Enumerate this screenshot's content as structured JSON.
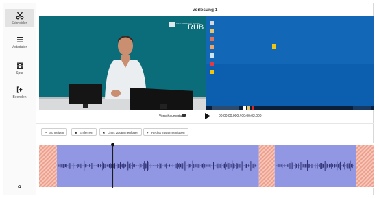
{
  "sidebar": {
    "items": [
      {
        "label": "Schneiden",
        "icon": "scissors-icon"
      },
      {
        "label": "Metadaten",
        "icon": "list-icon"
      },
      {
        "label": "Spur",
        "icon": "film-icon"
      },
      {
        "label": "Beenden",
        "icon": "exit-icon"
      }
    ],
    "settings_icon": "gear-icon"
  },
  "header": {
    "title": "Vorlesung 1"
  },
  "video": {
    "logo_text": "RUB",
    "logo_small": "RUHR UNIVERSITÄT BOCHUM"
  },
  "controls": {
    "previewmode_label": "Vorschaumodus",
    "time_display": "00:00:00.000 / 00:00:02.000"
  },
  "toolbar": {
    "cut_label": "Schneiden",
    "delete_label": "Entfernen",
    "merge_left_label": "Links zusammenfügen",
    "merge_right_label": "Rechts zusammenfügen"
  },
  "timeline": {
    "playhead_position_fraction": 0.22,
    "segments": [
      {
        "state": "deleted",
        "start": 0.0,
        "end": 0.053
      },
      {
        "state": "active",
        "start": 0.053,
        "end": 0.656
      },
      {
        "state": "deleted",
        "start": 0.656,
        "end": 0.703
      },
      {
        "state": "active",
        "start": 0.703,
        "end": 0.945
      },
      {
        "state": "deleted",
        "start": 0.945,
        "end": 1.0
      }
    ],
    "colors": {
      "active": "#9297e3",
      "deleted": "#f2b7a9",
      "waveform": "#2c2f6e",
      "playhead": "#111111"
    }
  }
}
